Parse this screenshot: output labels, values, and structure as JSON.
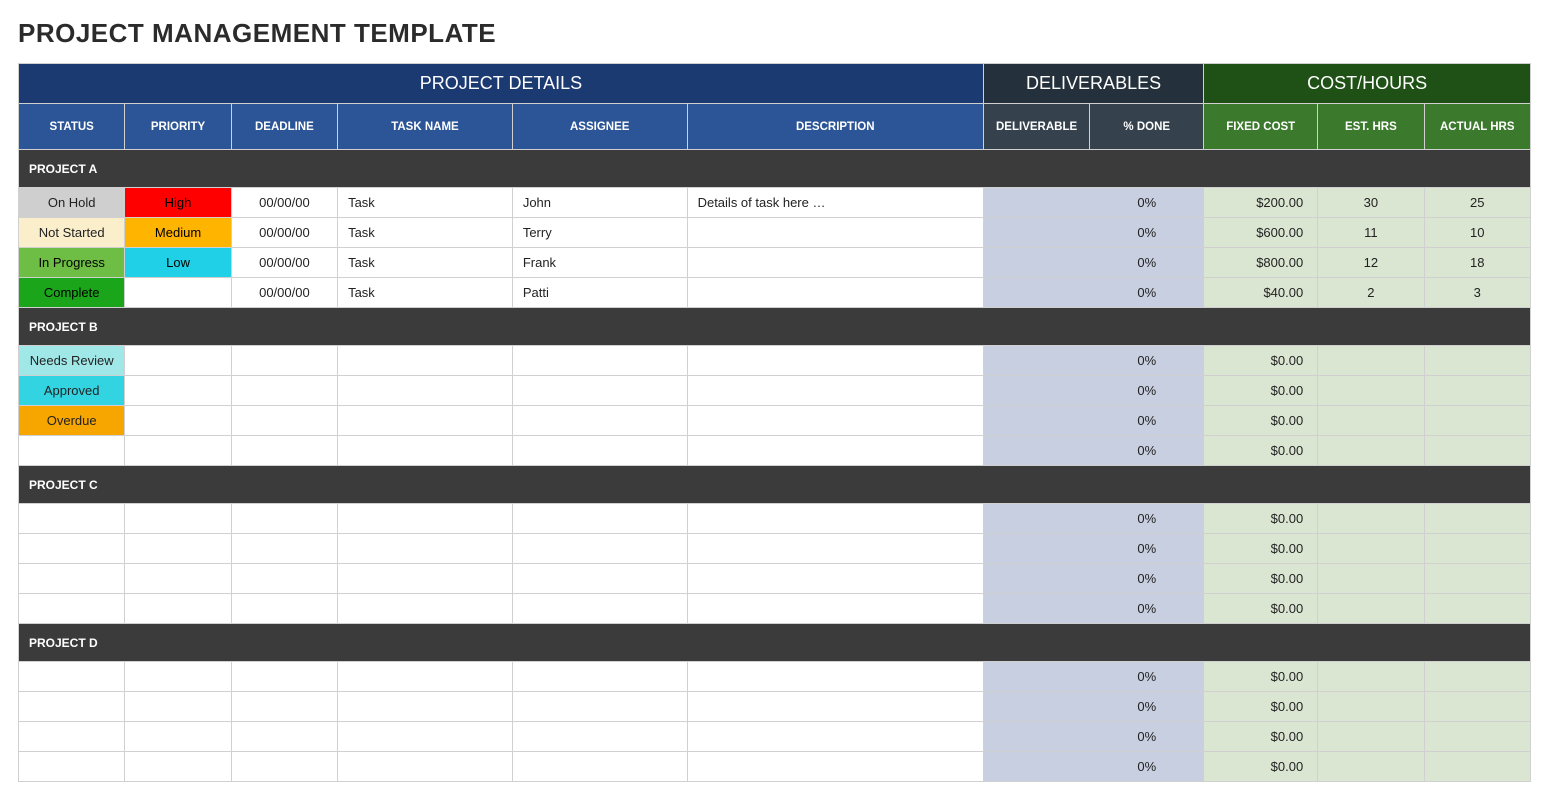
{
  "title": "PROJECT MANAGEMENT TEMPLATE",
  "sections": {
    "details": "PROJECT DETAILS",
    "deliverables": "DELIVERABLES",
    "costhours": "COST/HOURS"
  },
  "columns": {
    "status": "STATUS",
    "priority": "PRIORITY",
    "deadline": "DEADLINE",
    "task": "TASK NAME",
    "assignee": "ASSIGNEE",
    "desc": "DESCRIPTION",
    "deliverable": "DELIVERABLE",
    "done": "% DONE",
    "cost": "FIXED COST",
    "est": "EST. HRS",
    "act": "ACTUAL HRS"
  },
  "status_class": {
    "On Hold": "st-on-hold",
    "Not Started": "st-not-started",
    "In Progress": "st-in-progress",
    "Complete": "st-complete",
    "Needs Review": "st-needs-review",
    "Approved": "st-approved",
    "Overdue": "st-overdue"
  },
  "priority_class": {
    "High": "pr-high",
    "Medium": "pr-medium",
    "Low": "pr-low"
  },
  "groups": [
    {
      "name": "PROJECT A",
      "rows": [
        {
          "status": "On Hold",
          "priority": "High",
          "deadline": "00/00/00",
          "task": "Task",
          "assignee": "John",
          "desc": "Details of task here …",
          "deliverable": "",
          "done": "0%",
          "cost": "$200.00",
          "est": "30",
          "act": "25"
        },
        {
          "status": "Not Started",
          "priority": "Medium",
          "deadline": "00/00/00",
          "task": "Task",
          "assignee": "Terry",
          "desc": "",
          "deliverable": "",
          "done": "0%",
          "cost": "$600.00",
          "est": "11",
          "act": "10"
        },
        {
          "status": "In Progress",
          "priority": "Low",
          "deadline": "00/00/00",
          "task": "Task",
          "assignee": "Frank",
          "desc": "",
          "deliverable": "",
          "done": "0%",
          "cost": "$800.00",
          "est": "12",
          "act": "18"
        },
        {
          "status": "Complete",
          "priority": "",
          "deadline": "00/00/00",
          "task": "Task",
          "assignee": "Patti",
          "desc": "",
          "deliverable": "",
          "done": "0%",
          "cost": "$40.00",
          "est": "2",
          "act": "3"
        }
      ]
    },
    {
      "name": "PROJECT B",
      "rows": [
        {
          "status": "Needs Review",
          "priority": "",
          "deadline": "",
          "task": "",
          "assignee": "",
          "desc": "",
          "deliverable": "",
          "done": "0%",
          "cost": "$0.00",
          "est": "",
          "act": ""
        },
        {
          "status": "Approved",
          "priority": "",
          "deadline": "",
          "task": "",
          "assignee": "",
          "desc": "",
          "deliverable": "",
          "done": "0%",
          "cost": "$0.00",
          "est": "",
          "act": ""
        },
        {
          "status": "Overdue",
          "priority": "",
          "deadline": "",
          "task": "",
          "assignee": "",
          "desc": "",
          "deliverable": "",
          "done": "0%",
          "cost": "$0.00",
          "est": "",
          "act": ""
        },
        {
          "status": "",
          "priority": "",
          "deadline": "",
          "task": "",
          "assignee": "",
          "desc": "",
          "deliverable": "",
          "done": "0%",
          "cost": "$0.00",
          "est": "",
          "act": ""
        }
      ]
    },
    {
      "name": "PROJECT C",
      "rows": [
        {
          "status": "",
          "priority": "",
          "deadline": "",
          "task": "",
          "assignee": "",
          "desc": "",
          "deliverable": "",
          "done": "0%",
          "cost": "$0.00",
          "est": "",
          "act": ""
        },
        {
          "status": "",
          "priority": "",
          "deadline": "",
          "task": "",
          "assignee": "",
          "desc": "",
          "deliverable": "",
          "done": "0%",
          "cost": "$0.00",
          "est": "",
          "act": ""
        },
        {
          "status": "",
          "priority": "",
          "deadline": "",
          "task": "",
          "assignee": "",
          "desc": "",
          "deliverable": "",
          "done": "0%",
          "cost": "$0.00",
          "est": "",
          "act": ""
        },
        {
          "status": "",
          "priority": "",
          "deadline": "",
          "task": "",
          "assignee": "",
          "desc": "",
          "deliverable": "",
          "done": "0%",
          "cost": "$0.00",
          "est": "",
          "act": ""
        }
      ]
    },
    {
      "name": "PROJECT D",
      "rows": [
        {
          "status": "",
          "priority": "",
          "deadline": "",
          "task": "",
          "assignee": "",
          "desc": "",
          "deliverable": "",
          "done": "0%",
          "cost": "$0.00",
          "est": "",
          "act": ""
        },
        {
          "status": "",
          "priority": "",
          "deadline": "",
          "task": "",
          "assignee": "",
          "desc": "",
          "deliverable": "",
          "done": "0%",
          "cost": "$0.00",
          "est": "",
          "act": ""
        },
        {
          "status": "",
          "priority": "",
          "deadline": "",
          "task": "",
          "assignee": "",
          "desc": "",
          "deliverable": "",
          "done": "0%",
          "cost": "$0.00",
          "est": "",
          "act": ""
        },
        {
          "status": "",
          "priority": "",
          "deadline": "",
          "task": "",
          "assignee": "",
          "desc": "",
          "deliverable": "",
          "done": "0%",
          "cost": "$0.00",
          "est": "",
          "act": ""
        }
      ]
    }
  ]
}
